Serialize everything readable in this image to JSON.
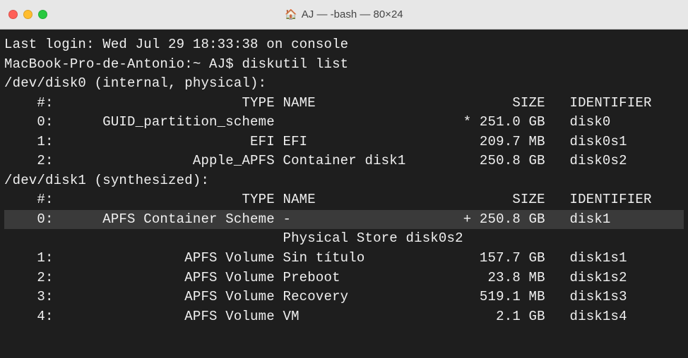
{
  "window": {
    "title": "AJ — -bash — 80×24"
  },
  "session": {
    "last_login": "Last login: Wed Jul 29 18:33:38 on console",
    "prompt": "MacBook-Pro-de-Antonio:~ AJ$ ",
    "command": "diskutil list"
  },
  "disks": [
    {
      "device": "/dev/disk0 (internal, physical):",
      "header": {
        "idx": "#:",
        "type": "TYPE",
        "name": "NAME",
        "size": "SIZE",
        "identifier": "IDENTIFIER"
      },
      "rows": [
        {
          "idx": "0:",
          "type": "GUID_partition_scheme",
          "name": "",
          "size": "*251.0 GB",
          "identifier": "disk0",
          "hl": false
        },
        {
          "idx": "1:",
          "type": "EFI",
          "name": "EFI",
          "size": "209.7 MB",
          "identifier": "disk0s1",
          "hl": false
        },
        {
          "idx": "2:",
          "type": "Apple_APFS",
          "name": "Container disk1",
          "size": "250.8 GB",
          "identifier": "disk0s2",
          "hl": false
        }
      ]
    },
    {
      "device": "/dev/disk1 (synthesized):",
      "header": {
        "idx": "#:",
        "type": "TYPE",
        "name": "NAME",
        "size": "SIZE",
        "identifier": "IDENTIFIER"
      },
      "rows": [
        {
          "idx": "0:",
          "type": "APFS Container Scheme",
          "name": "-",
          "size": "+250.8 GB",
          "identifier": "disk1",
          "hl": true
        },
        {
          "idx": "",
          "type": "",
          "name": "Physical Store disk0s2",
          "size": "",
          "identifier": "",
          "hl": false
        },
        {
          "idx": "1:",
          "type": "APFS Volume",
          "name": "Sin título",
          "size": "157.7 GB",
          "identifier": "disk1s1",
          "hl": false
        },
        {
          "idx": "2:",
          "type": "APFS Volume",
          "name": "Preboot",
          "size": "23.8 MB",
          "identifier": "disk1s2",
          "hl": false
        },
        {
          "idx": "3:",
          "type": "APFS Volume",
          "name": "Recovery",
          "size": "519.1 MB",
          "identifier": "disk1s3",
          "hl": false
        },
        {
          "idx": "4:",
          "type": "APFS Volume",
          "name": "VM",
          "size": "2.1 GB",
          "identifier": "disk1s4",
          "hl": false
        }
      ]
    }
  ]
}
